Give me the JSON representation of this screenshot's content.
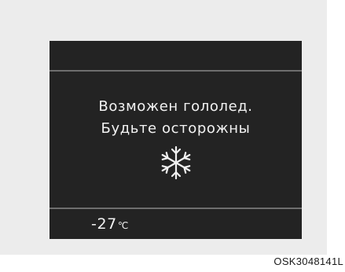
{
  "display": {
    "message_line1": "Возможен гололед.",
    "message_line2": "Будьте осторожны",
    "warning_icon": "snowflake-icon",
    "outside_temperature": {
      "value": "-27",
      "unit": "℃"
    }
  },
  "figure_code": "OSK3048141L",
  "colors": {
    "panel_background": "#ececec",
    "screen_background": "#232323",
    "divider": "#6e6e6e",
    "text": "#f2f2f2"
  }
}
